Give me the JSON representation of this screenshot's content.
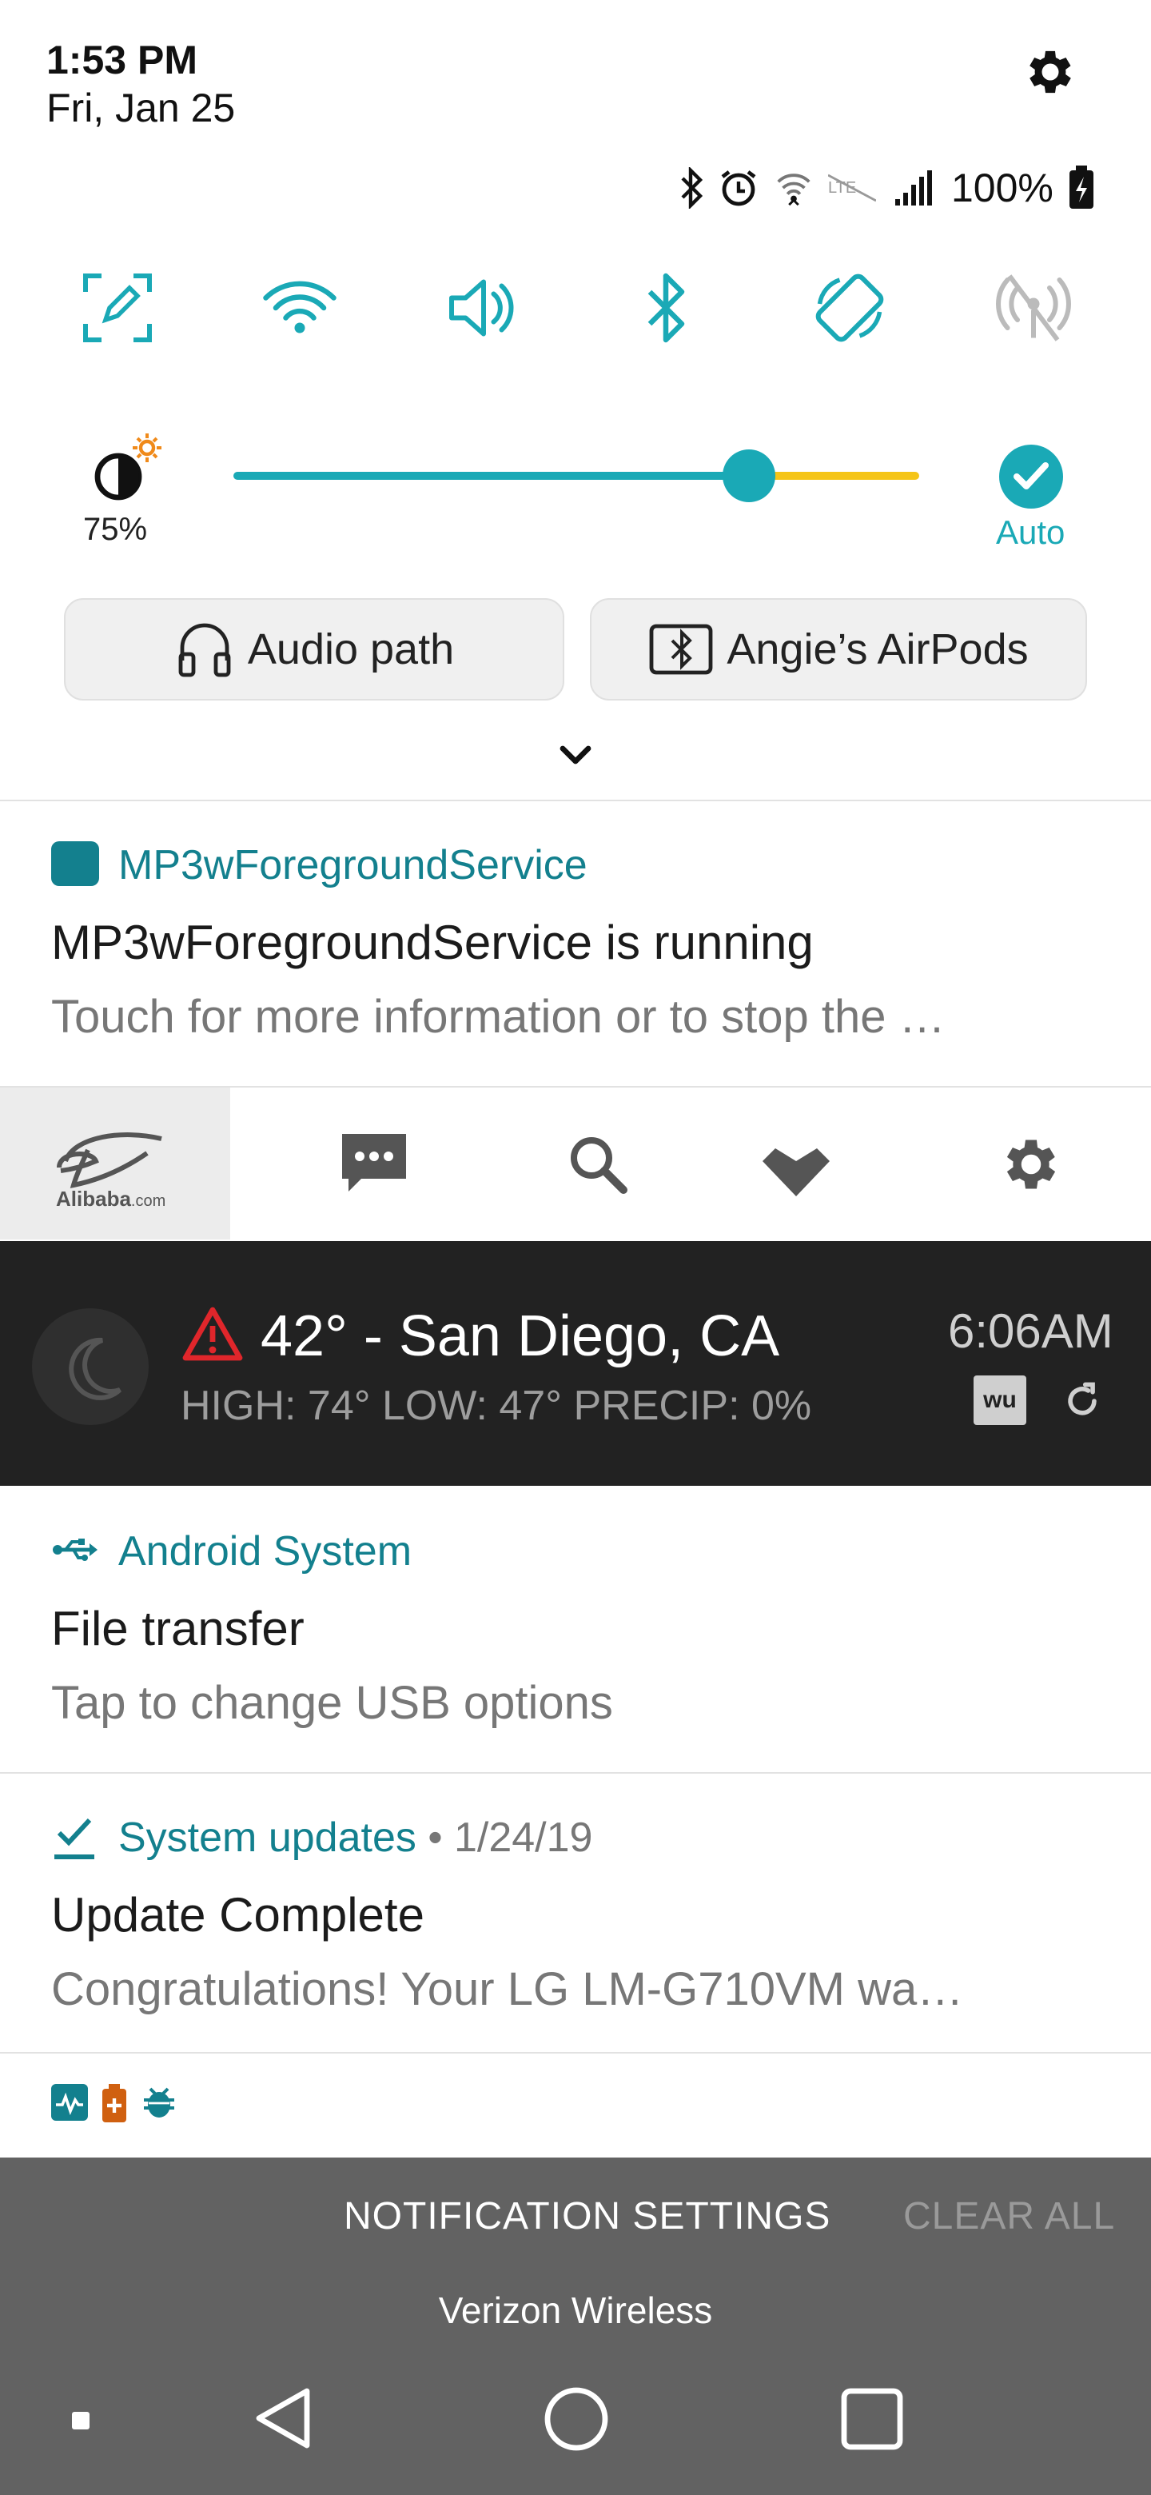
{
  "header": {
    "time": "1:53 PM",
    "date": "Fri, Jan 25",
    "settings_icon": "gear-icon"
  },
  "status_bar": {
    "battery_percent": "100%",
    "icons": [
      "bluetooth-icon",
      "alarm-icon",
      "wifi-signal-icon",
      "lte-icon",
      "cell-signal-icon",
      "battery-charging-icon"
    ]
  },
  "quick_tiles": [
    "screen-capture-icon",
    "wifi-icon",
    "sound-icon",
    "bluetooth-icon",
    "auto-rotate-icon",
    "hotspot-off-icon"
  ],
  "brightness": {
    "percent_label": "75%",
    "level": 0.75,
    "auto_label": "Auto"
  },
  "audio": {
    "path_label": "Audio path",
    "device_label": "Angie’s AirPods"
  },
  "notifications": {
    "mp3w": {
      "app": "MP3wForegroundService",
      "title": "MP3wForegroundService is running",
      "body": "Touch for more information or to stop the …"
    },
    "alibaba": {
      "logo_text": "Alibaba",
      "logo_domain": ".com"
    },
    "weather": {
      "main": "42° - San Diego, CA",
      "sub": "HIGH: 74° LOW: 47° PRECIP: 0%",
      "time": "6:06AM",
      "wu_label": "wu"
    },
    "android_system": {
      "app": "Android System",
      "title": "File transfer",
      "body": "Tap to change USB options"
    },
    "system_updates": {
      "app": "System updates",
      "date": " • 1/24/19",
      "title": "Update Complete",
      "body": "Congratulations! Your LG LM-G710VM wa…"
    }
  },
  "footer": {
    "notification_settings": "NOTIFICATION SETTINGS",
    "clear_all": "CLEAR ALL",
    "carrier": "Verizon Wireless"
  },
  "colors": {
    "accent": "#1aa9b6",
    "app_label": "#13808e",
    "slider_rest": "#f5c518",
    "warning": "#e0262b",
    "weather_bg": "#222222",
    "bottom_bg": "#626262"
  }
}
